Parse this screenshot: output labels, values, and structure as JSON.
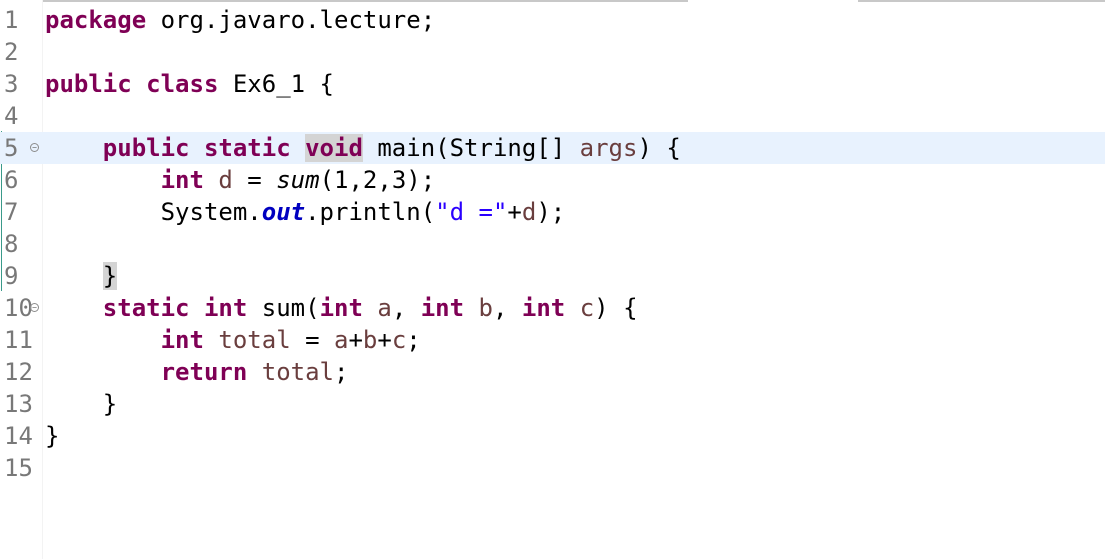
{
  "editor": {
    "colors": {
      "keyword": "#7f0055",
      "string": "#2a00ff",
      "field": "#0000c0",
      "variable": "#6a3e3e",
      "line_number": "#787878",
      "current_line": "#e8f2fe",
      "bracket_highlight": "#d4d4d4"
    },
    "lines": [
      {
        "num": "1",
        "tokens": [
          {
            "t": "package",
            "c": "kw"
          },
          {
            "t": " org.javaro.lecture;",
            "c": "plain"
          }
        ]
      },
      {
        "num": "2",
        "tokens": []
      },
      {
        "num": "3",
        "tokens": [
          {
            "t": "public",
            "c": "kw"
          },
          {
            "t": " ",
            "c": "plain"
          },
          {
            "t": "class",
            "c": "kw"
          },
          {
            "t": " Ex6_1 {",
            "c": "plain"
          }
        ]
      },
      {
        "num": "4",
        "tokens": []
      },
      {
        "num": "5",
        "fold": true,
        "current": true,
        "tokens": [
          {
            "t": "    ",
            "c": "plain"
          },
          {
            "t": "public",
            "c": "kw"
          },
          {
            "t": " ",
            "c": "plain"
          },
          {
            "t": "static",
            "c": "kw"
          },
          {
            "t": " ",
            "c": "plain"
          },
          {
            "t": "",
            "c": "cursor"
          },
          {
            "t": "void",
            "c": "kw occur"
          },
          {
            "t": " main(String[] ",
            "c": "plain"
          },
          {
            "t": "args",
            "c": "param"
          },
          {
            "t": ") {",
            "c": "plain"
          }
        ]
      },
      {
        "num": "6",
        "tokens": [
          {
            "t": "        ",
            "c": "plain"
          },
          {
            "t": "int",
            "c": "kw"
          },
          {
            "t": " ",
            "c": "plain"
          },
          {
            "t": "d",
            "c": "local"
          },
          {
            "t": " = ",
            "c": "plain"
          },
          {
            "t": "sum",
            "c": "static-call"
          },
          {
            "t": "(1,2,3);",
            "c": "plain"
          }
        ]
      },
      {
        "num": "7",
        "tokens": [
          {
            "t": "        System.",
            "c": "plain"
          },
          {
            "t": "out",
            "c": "field"
          },
          {
            "t": ".println(",
            "c": "plain"
          },
          {
            "t": "\"d =\"",
            "c": "str"
          },
          {
            "t": "+",
            "c": "plain"
          },
          {
            "t": "d",
            "c": "local"
          },
          {
            "t": ");",
            "c": "plain"
          }
        ]
      },
      {
        "num": "8",
        "tokens": []
      },
      {
        "num": "9",
        "tokens": [
          {
            "t": "    ",
            "c": "plain"
          },
          {
            "t": "}",
            "c": "plain occur"
          }
        ]
      },
      {
        "num": "10",
        "fold": true,
        "tokens": [
          {
            "t": "    ",
            "c": "plain"
          },
          {
            "t": "static",
            "c": "kw"
          },
          {
            "t": " ",
            "c": "plain"
          },
          {
            "t": "int",
            "c": "kw"
          },
          {
            "t": " sum(",
            "c": "plain"
          },
          {
            "t": "int",
            "c": "kw"
          },
          {
            "t": " ",
            "c": "plain"
          },
          {
            "t": "a",
            "c": "param"
          },
          {
            "t": ", ",
            "c": "plain"
          },
          {
            "t": "int",
            "c": "kw"
          },
          {
            "t": " ",
            "c": "plain"
          },
          {
            "t": "b",
            "c": "param"
          },
          {
            "t": ", ",
            "c": "plain"
          },
          {
            "t": "int",
            "c": "kw"
          },
          {
            "t": " ",
            "c": "plain"
          },
          {
            "t": "c",
            "c": "param"
          },
          {
            "t": ") {",
            "c": "plain"
          }
        ]
      },
      {
        "num": "11",
        "tokens": [
          {
            "t": "        ",
            "c": "plain"
          },
          {
            "t": "int",
            "c": "kw"
          },
          {
            "t": " ",
            "c": "plain"
          },
          {
            "t": "total",
            "c": "local"
          },
          {
            "t": " = ",
            "c": "plain"
          },
          {
            "t": "a",
            "c": "param"
          },
          {
            "t": "+",
            "c": "plain"
          },
          {
            "t": "b",
            "c": "param"
          },
          {
            "t": "+",
            "c": "plain"
          },
          {
            "t": "c",
            "c": "param"
          },
          {
            "t": ";",
            "c": "plain"
          }
        ]
      },
      {
        "num": "12",
        "tokens": [
          {
            "t": "        ",
            "c": "plain"
          },
          {
            "t": "return",
            "c": "kw"
          },
          {
            "t": " ",
            "c": "plain"
          },
          {
            "t": "total",
            "c": "local"
          },
          {
            "t": ";",
            "c": "plain"
          }
        ]
      },
      {
        "num": "13",
        "tokens": [
          {
            "t": "    }",
            "c": "plain"
          }
        ]
      },
      {
        "num": "14",
        "tokens": [
          {
            "t": "}",
            "c": "plain"
          }
        ]
      },
      {
        "num": "15",
        "tokens": []
      }
    ]
  }
}
